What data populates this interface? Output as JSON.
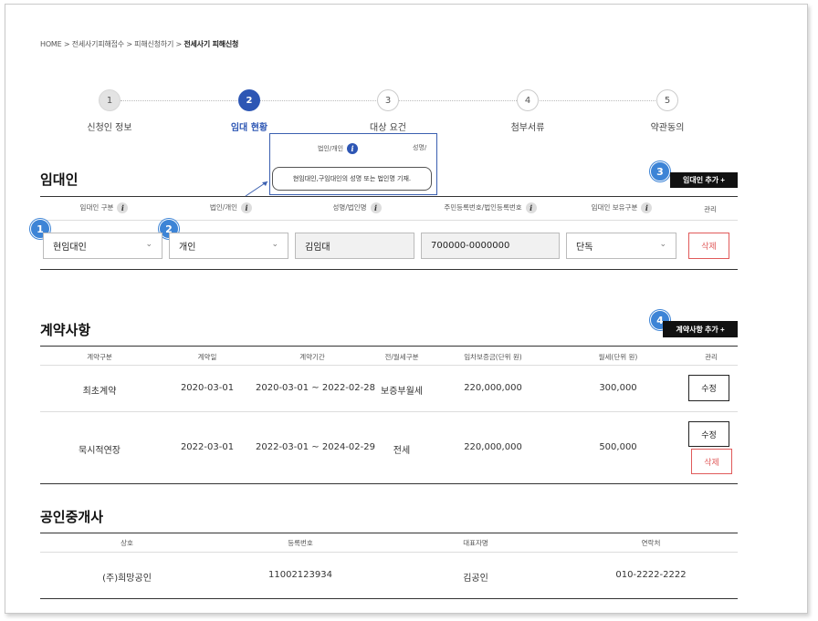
{
  "breadcrumb": {
    "home": "HOME",
    "sep": ">",
    "level1": "전세사기피해접수",
    "level2": "피해신청하기",
    "current": "전세사기 피해신청"
  },
  "steps": [
    {
      "num": "1",
      "label": "신청인 정보",
      "state": "done"
    },
    {
      "num": "2",
      "label": "임대 현황",
      "state": "active"
    },
    {
      "num": "3",
      "label": "대상 요건",
      "state": "todo"
    },
    {
      "num": "4",
      "label": "첨부서류",
      "state": "todo"
    },
    {
      "num": "5",
      "label": "약관동의",
      "state": "todo"
    }
  ],
  "tooltip": {
    "header_left": "법인/개인",
    "header_right": "성명/",
    "text": "현임대인,구임대인의 성명 또는 법인명 기재."
  },
  "landlord": {
    "title": "임대인",
    "add_button": "임대인 추가 +",
    "headers": [
      "임대인 구분",
      "법인/개인",
      "성명/법인명",
      "주민등록번호/법인등록번호",
      "임대인 보유구분",
      "관리"
    ],
    "row": {
      "type": "현임대인",
      "entity": "개인",
      "name": "김임대",
      "reg_no": "700000-0000000",
      "ownership": "단독",
      "delete": "삭제"
    }
  },
  "contract": {
    "title": "계약사항",
    "add_button": "계약사항 추가 +",
    "headers": [
      "계약구분",
      "계약일",
      "계약기간",
      "전/월세구분",
      "임차보증금(단위 원)",
      "월세(단위 원)",
      "관리"
    ],
    "rows": [
      {
        "kind": "최초계약",
        "date": "2020-03-01",
        "period": "2020-03-01 ~ 2022-02-28",
        "rent_type": "보증부월세",
        "deposit": "220,000,000",
        "monthly": "300,000",
        "edit": "수정"
      },
      {
        "kind": "묵시적연장",
        "date": "2022-03-01",
        "period": "2022-03-01 ~ 2024-02-29",
        "rent_type": "전세",
        "deposit": "220,000,000",
        "monthly": "500,000",
        "edit": "수정",
        "delete": "삭제"
      }
    ]
  },
  "broker": {
    "title": "공인중개사",
    "headers": [
      "상호",
      "등록번호",
      "대표자명",
      "연락처"
    ],
    "row": {
      "company": "(주)희망공인",
      "reg_no": "11002123934",
      "rep": "김공인",
      "phone": "010-2222-2222"
    }
  },
  "badges": [
    "1",
    "2",
    "3",
    "4"
  ],
  "icons": {
    "info": "i",
    "chevron": "⌄"
  },
  "colors": {
    "accent": "#2d56b4",
    "badge": "#3d84d6",
    "delete": "#e05a5a"
  }
}
